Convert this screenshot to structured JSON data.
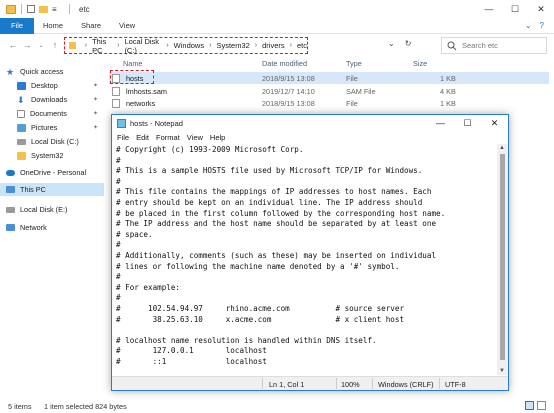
{
  "explorer": {
    "window_title": "etc",
    "ribbon": {
      "file": "File",
      "tabs": [
        "Home",
        "Share",
        "View"
      ]
    },
    "address": {
      "crumbs": [
        "This PC",
        "Local Disk (C:)",
        "Windows",
        "System32",
        "drivers",
        "etc"
      ],
      "search_placeholder": "Search etc"
    },
    "nav": [
      {
        "label": "Quick access",
        "icon": "star-icon",
        "color": "#2b7bd0"
      },
      {
        "label": "Desktop",
        "icon": "desktop-icon",
        "color": "#2b7bd0",
        "pinned": true
      },
      {
        "label": "Downloads",
        "icon": "download-icon",
        "color": "#2b7bd0",
        "pinned": true
      },
      {
        "label": "Documents",
        "icon": "documents-icon",
        "color": "#8a8a8a",
        "pinned": true
      },
      {
        "label": "Pictures",
        "icon": "pictures-icon",
        "color": "#5a9bd5",
        "pinned": true
      },
      {
        "label": "Local Disk (C:)",
        "icon": "drive-icon",
        "color": "#7a7a7a"
      },
      {
        "label": "System32",
        "icon": "folder-icon",
        "color": "#f3c14b"
      },
      {
        "label": "OneDrive - Personal",
        "icon": "cloud-icon",
        "color": "#1979ca"
      },
      {
        "label": "This PC",
        "icon": "pc-icon",
        "color": "#4a90d9"
      },
      {
        "label": "Local Disk (E:)",
        "icon": "drive-icon",
        "color": "#7a7a7a"
      },
      {
        "label": "Network",
        "icon": "network-icon",
        "color": "#4a90d9"
      }
    ],
    "columns": {
      "name": "Name",
      "date": "Date modified",
      "type": "Type",
      "size": "Size"
    },
    "files": [
      {
        "name": "hosts",
        "date": "2018/9/15 13:08",
        "type": "File",
        "size": "1 KB"
      },
      {
        "name": "lmhosts.sam",
        "date": "2019/12/7 14:10",
        "type": "SAM File",
        "size": "4 KB"
      },
      {
        "name": "networks",
        "date": "2018/9/15 13:08",
        "type": "File",
        "size": "1 KB"
      }
    ],
    "status": {
      "items": "5 items",
      "selected": "1 item selected  824 bytes"
    }
  },
  "notepad": {
    "title": "hosts - Notepad",
    "menu": [
      "File",
      "Edit",
      "Format",
      "View",
      "Help"
    ],
    "content": "# Copyright (c) 1993-2009 Microsoft Corp.\n#\n# This is a sample HOSTS file used by Microsoft TCP/IP for Windows.\n#\n# This file contains the mappings of IP addresses to host names. Each\n# entry should be kept on an individual line. The IP address should\n# be placed in the first column followed by the corresponding host name.\n# The IP address and the host name should be separated by at least one\n# space.\n#\n# Additionally, comments (such as these) may be inserted on individual\n# lines or following the machine name denoted by a '#' symbol.\n#\n# For example:\n#\n#      102.54.94.97     rhino.acme.com          # source server\n#       38.25.63.10     x.acme.com              # x client host\n\n# localhost name resolution is handled within DNS itself.\n#\t127.0.0.1       localhost\n#\t::1             localhost",
    "status": {
      "position": "Ln 1, Col 1",
      "zoom": "100%",
      "eol": "Windows (CRLF)",
      "encoding": "UTF-8"
    }
  }
}
